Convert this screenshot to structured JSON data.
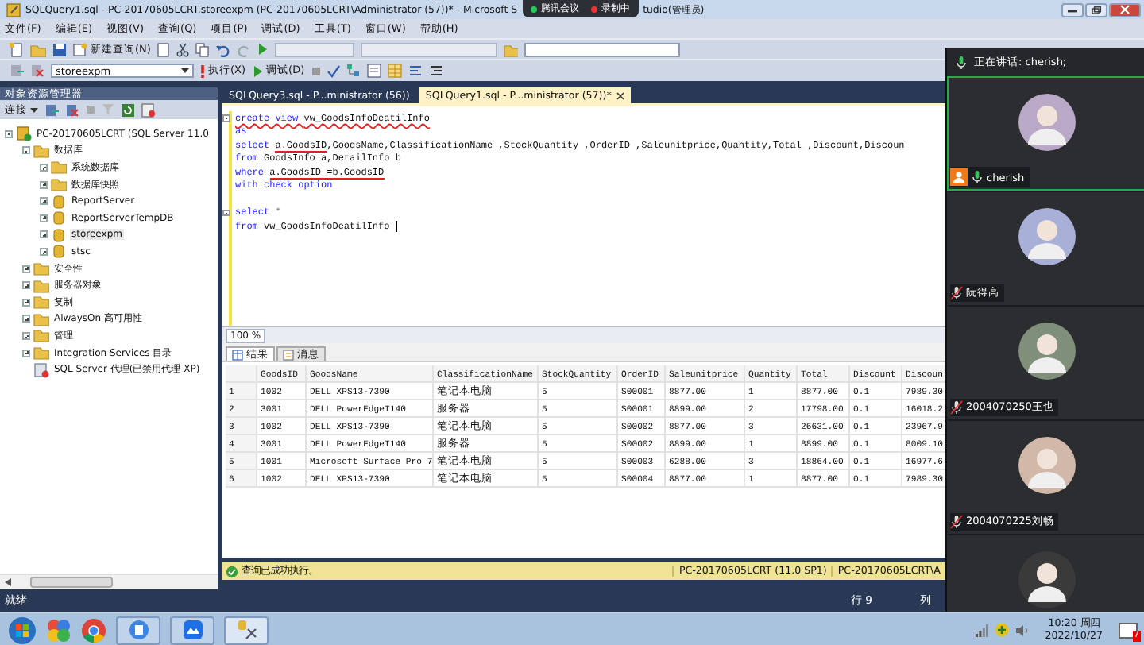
{
  "window": {
    "title": "SQLQuery1.sql - PC-20170605LCRT.storeexpm (PC-20170605LCRT\\Administrator (57))* - Microsoft S",
    "title_end": "tudio(管理员)"
  },
  "meeting_overlay": {
    "app": "腾讯会议",
    "recording": "录制中"
  },
  "menu": [
    "文件(F)",
    "编辑(E)",
    "视图(V)",
    "查询(Q)",
    "项目(P)",
    "调试(D)",
    "工具(T)",
    "窗口(W)",
    "帮助(H)"
  ],
  "toolbar": {
    "new_query": "新建查询(N)",
    "database": "storeexpm",
    "execute": "执行(X)",
    "debug": "调试(D)"
  },
  "object_explorer": {
    "title": "对象资源管理器",
    "connect": "连接",
    "tree": [
      {
        "label": "PC-20170605LCRT (SQL Server 11.0",
        "kind": "server",
        "expanded": true,
        "selected": false,
        "children": [
          {
            "label": "数据库",
            "kind": "folder",
            "expanded": true,
            "selected": false,
            "children": [
              {
                "label": "系统数据库",
                "kind": "folder",
                "expanded": false,
                "selected": false
              },
              {
                "label": "数据库快照",
                "kind": "folder",
                "expanded": false,
                "selected": false
              },
              {
                "label": "ReportServer",
                "kind": "database",
                "expanded": false,
                "selected": false
              },
              {
                "label": "ReportServerTempDB",
                "kind": "database",
                "expanded": false,
                "selected": false
              },
              {
                "label": "storeexpm",
                "kind": "database",
                "expanded": false,
                "selected": true
              },
              {
                "label": "stsc",
                "kind": "database",
                "expanded": false,
                "selected": false
              }
            ]
          },
          {
            "label": "安全性",
            "kind": "folder",
            "expanded": false,
            "selected": false
          },
          {
            "label": "服务器对象",
            "kind": "folder",
            "expanded": false,
            "selected": false
          },
          {
            "label": "复制",
            "kind": "folder",
            "expanded": false,
            "selected": false
          },
          {
            "label": "AlwaysOn 高可用性",
            "kind": "folder",
            "expanded": false,
            "selected": false
          },
          {
            "label": "管理",
            "kind": "folder",
            "expanded": false,
            "selected": false
          },
          {
            "label": "Integration Services 目录",
            "kind": "folder",
            "expanded": false,
            "selected": false
          },
          {
            "label": "SQL Server 代理(已禁用代理 XP)",
            "kind": "agent",
            "selected": false
          }
        ]
      }
    ]
  },
  "editor": {
    "tabs": [
      {
        "label": "SQLQuery3.sql - P...ministrator (56))",
        "selected": false
      },
      {
        "label": "SQLQuery1.sql - P...ministrator (57))*",
        "selected": true
      }
    ],
    "lines": [
      {
        "fold": true,
        "segments": [
          {
            "text": "create view ",
            "kind": "keyword",
            "squiggle": true
          },
          {
            "text": "vw_GoodsInfoDeatilInfo",
            "kind": "plain",
            "squiggle": true
          }
        ]
      },
      {
        "fold": false,
        "segments": [
          {
            "text": "as",
            "kind": "keyword"
          }
        ]
      },
      {
        "fold": false,
        "segments": [
          {
            "text": "select ",
            "kind": "keyword"
          },
          {
            "text": "a.GoodsID",
            "kind": "plain",
            "annotated": true
          },
          {
            "text": ",GoodsName,ClassificationName ,StockQuantity ,OrderID ,Saleunitprice,Quantity,Total ,Discount,Discoun",
            "kind": "plain"
          }
        ]
      },
      {
        "fold": false,
        "segments": [
          {
            "text": "from",
            "kind": "keyword"
          },
          {
            "text": " GoodsInfo a,DetailInfo b",
            "kind": "plain"
          }
        ]
      },
      {
        "fold": false,
        "segments": [
          {
            "text": "where ",
            "kind": "keyword"
          },
          {
            "text": "a.GoodsID =b.GoodsID",
            "kind": "plain",
            "annotated": true
          }
        ]
      },
      {
        "fold": false,
        "segments": [
          {
            "text": "with check option",
            "kind": "keyword"
          }
        ]
      },
      {
        "fold": false
      },
      {
        "fold": true,
        "segments": [
          {
            "text": "select",
            "kind": "keyword"
          },
          {
            "text": " *",
            "kind": "operator"
          }
        ]
      },
      {
        "fold": false,
        "cursor": true,
        "segments": [
          {
            "text": "from",
            "kind": "keyword"
          },
          {
            "text": " vw_GoodsInfoDeatilInfo ",
            "kind": "plain"
          }
        ]
      }
    ],
    "zoom": "100 %"
  },
  "results": {
    "tabs": [
      {
        "label": "结果",
        "selected": true
      },
      {
        "label": "消息",
        "selected": false
      }
    ],
    "columns": [
      "GoodsID",
      "GoodsName",
      "ClassificationName",
      "StockQuantity",
      "OrderID",
      "Saleunitprice",
      "Quantity",
      "Total",
      "Discount",
      "Discoun"
    ],
    "rows": [
      {
        "number": "1",
        "cells": [
          "1002",
          "DELL XPS13-7390",
          "笔记本电脑",
          "5",
          "S00001",
          "8877.00",
          "1",
          "8877.00",
          "0.1",
          "7989.30"
        ]
      },
      {
        "number": "2",
        "cells": [
          "3001",
          "DELL PowerEdgeT140",
          "服务器",
          "5",
          "S00001",
          "8899.00",
          "2",
          "17798.00",
          "0.1",
          "16018.2"
        ]
      },
      {
        "number": "3",
        "cells": [
          "1002",
          "DELL XPS13-7390",
          "笔记本电脑",
          "5",
          "S00002",
          "8877.00",
          "3",
          "26631.00",
          "0.1",
          "23967.9"
        ]
      },
      {
        "number": "4",
        "cells": [
          "3001",
          "DELL PowerEdgeT140",
          "服务器",
          "5",
          "S00002",
          "8899.00",
          "1",
          "8899.00",
          "0.1",
          "8009.10"
        ]
      },
      {
        "number": "5",
        "cells": [
          "1001",
          "Microsoft Surface Pro 7",
          "笔记本电脑",
          "5",
          "S00003",
          "6288.00",
          "3",
          "18864.00",
          "0.1",
          "16977.6"
        ]
      },
      {
        "number": "6",
        "cells": [
          "1002",
          "DELL XPS13-7390",
          "笔记本电脑",
          "5",
          "S00004",
          "8877.00",
          "1",
          "8877.00",
          "0.1",
          "7989.30"
        ]
      }
    ]
  },
  "query_status": {
    "message": "查询已成功执行。",
    "server": "PC-20170605LCRT (11.0 SP1)",
    "user": "PC-20170605LCRT\\A"
  },
  "status_bar": {
    "state": "就绪",
    "row": "行 9",
    "column": "列"
  },
  "meeting": {
    "speaking": "正在讲话: cherish;",
    "participants": [
      {
        "name": "cherish",
        "selected": true,
        "muted": false,
        "host": true
      },
      {
        "name": "阮得高",
        "selected": false,
        "muted": true,
        "host": false
      },
      {
        "name": "2004070250王也",
        "selected": false,
        "muted": true,
        "host": false
      },
      {
        "name": "2004070225刘畅",
        "selected": false,
        "muted": true,
        "host": false
      },
      {
        "selected": false,
        "host": false
      }
    ]
  },
  "taskbar": {
    "time": "10:20 周四",
    "date": "2022/10/27",
    "badge": "7"
  }
}
